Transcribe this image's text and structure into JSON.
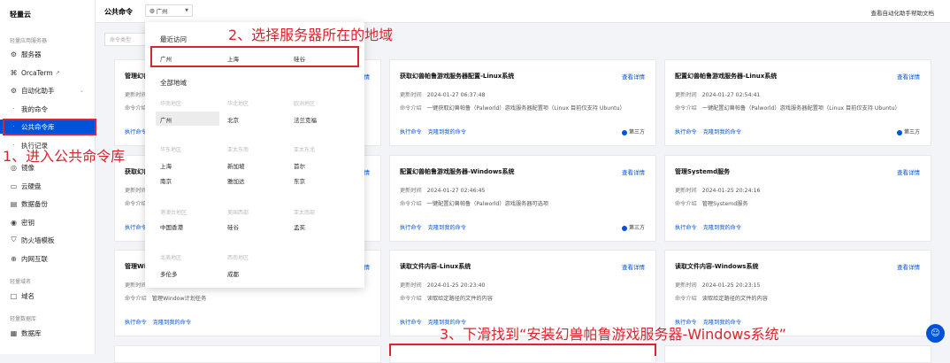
{
  "sidebar": {
    "brand": "轻量云",
    "sections": {
      "app": "轻量应用服务器",
      "domain": "轻量域名",
      "db": "轻量数据库"
    },
    "items": {
      "servers": "服务器",
      "orcaterm": "OrcaTerm",
      "automation": "自动化助手",
      "my_commands": "我的命令",
      "public_commands": "公共命令库",
      "exec_records": "执行记录",
      "images": "镜像",
      "cloud_disk": "云硬盘",
      "backup": "数据备份",
      "keys": "密钥",
      "firewall": "防火墙模板",
      "intranet": "内网互联",
      "domains": "域名",
      "database": "数据库"
    }
  },
  "topbar": {
    "title": "公共命令",
    "region_value": "广州",
    "help": "查看自动化助手帮助文档"
  },
  "filter": {
    "placeholder": "命令类型"
  },
  "dropdown": {
    "recent_label": "最近访问",
    "recent": [
      "广州",
      "上海",
      "硅谷"
    ],
    "all_label": "全部地域",
    "groups": [
      {
        "region": "华南地区",
        "cities": [
          "广州"
        ]
      },
      {
        "region": "华北地区",
        "cities": [
          "北京"
        ]
      },
      {
        "region": "欧洲地区",
        "cities": [
          "法兰克福"
        ]
      },
      {
        "region": "华东地区",
        "cities": [
          "上海",
          "南京"
        ]
      },
      {
        "region": "亚太东南",
        "cities": [
          "新加坡",
          "雅加达"
        ]
      },
      {
        "region": "亚太东北",
        "cities": [
          "首尔",
          "东京"
        ]
      },
      {
        "region": "港澳台地区",
        "cities": [
          "中国香港"
        ]
      },
      {
        "region": "美国西部",
        "cities": [
          "硅谷"
        ]
      },
      {
        "region": "亚太南部",
        "cities": [
          "孟买"
        ]
      },
      {
        "region": "北美地区",
        "cities": [
          "多伦多"
        ]
      },
      {
        "region": "西南地区",
        "cities": [
          "成都"
        ]
      }
    ]
  },
  "labels": {
    "detail": "查看详情",
    "updated": "更新时间",
    "intro": "命令介绍",
    "execute": "执行命令",
    "clone": "克隆到我的命令",
    "third_party": "第三方"
  },
  "cards": [
    {
      "title": "管理幻兽帕鲁游戏服务器",
      "time": "",
      "intro": "",
      "badge": ""
    },
    {
      "title": "获取幻兽帕鲁游戏服务器配置-Linux系统",
      "time": "2024-01-27 06:37:48",
      "intro": "一键获取幻兽帕鲁（Palworld）游戏服务器配置项（Linux 目前仅支持 Ubuntu）",
      "badge": "第三方"
    },
    {
      "title": "配置幻兽帕鲁游戏服务器-Linux系统",
      "time": "2024-01-27 02:54:41",
      "intro": "一键配置幻兽帕鲁（Palworld）游戏服务器配置项（Linux 目前仅支持 Ubuntu）",
      "badge": "第三方"
    },
    {
      "title": "获取幻兽帕鲁游戏服务器配置-Windows系统",
      "time": "",
      "intro": "",
      "badge": ""
    },
    {
      "title": "配置幻兽帕鲁游戏服务器-Windows系统",
      "time": "2024-01-27 02:46:45",
      "intro": "一键配置幻兽帕鲁（Palworld）游戏服务器可选项",
      "badge": "第三方"
    },
    {
      "title": "管理Systemd服务",
      "time": "2024-01-25 20:24:16",
      "intro": "管理Systemd服务",
      "badge": ""
    },
    {
      "title": "管理Windows计划任务",
      "time": "",
      "intro": "管理Window计划任务",
      "badge": ""
    },
    {
      "title": "读取文件内容-Linux系统",
      "time": "2024-01-25 20:23:40",
      "intro": "读取给定路径的文件的内容",
      "badge": ""
    },
    {
      "title": "读取文件内容-Windows系统",
      "time": "2024-01-25 20:23:15",
      "intro": "读取给定路径的文件的内容",
      "badge": ""
    }
  ],
  "annotations": {
    "step1": "1、进入公共命令库",
    "step2": "2、选择服务器所在的地域",
    "step3": "3、下滑找到“安装幻兽帕鲁游戏服务器-Windows系统”"
  },
  "colors": {
    "accent": "#0052d9",
    "annotation": "#d8262f"
  }
}
